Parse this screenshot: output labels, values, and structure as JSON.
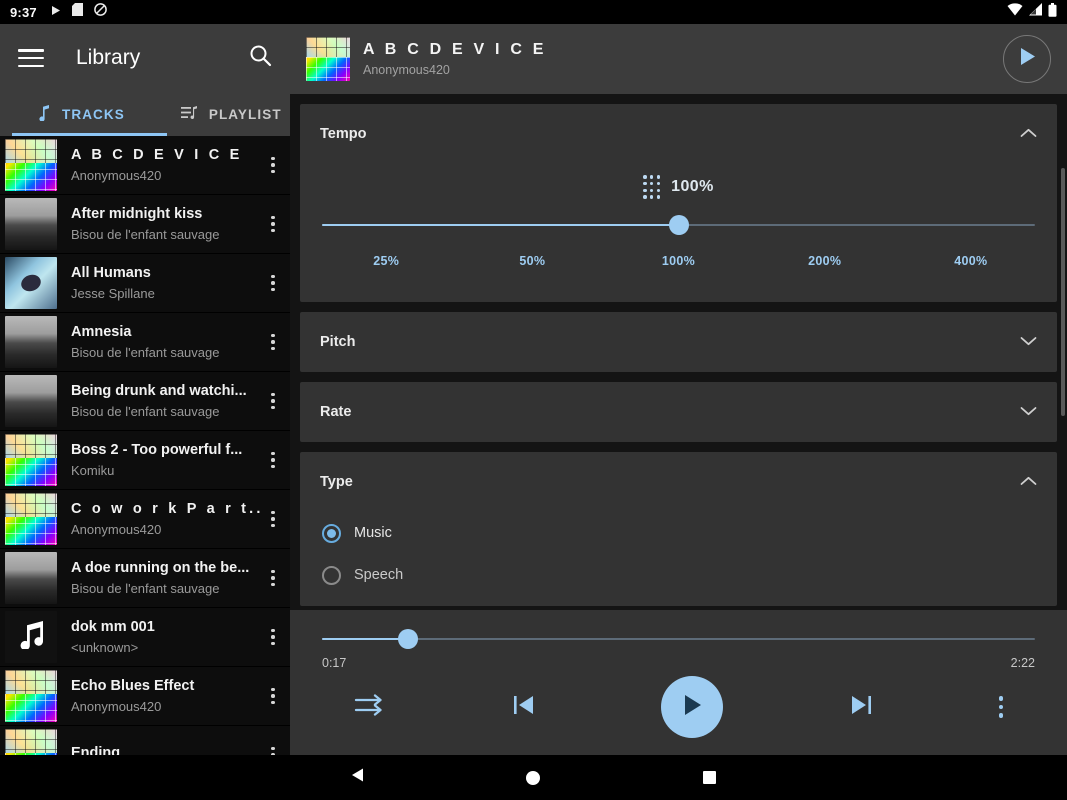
{
  "status_bar": {
    "time": "9:37",
    "icons_left": [
      "play-icon",
      "sd-card-icon",
      "mute-icon"
    ],
    "icons_right": [
      "wifi-icon",
      "signal-icon",
      "battery-icon"
    ]
  },
  "library": {
    "title": "Library",
    "menu_icon": "hamburger-menu-icon",
    "search_icon": "search-icon",
    "tabs": [
      {
        "label": "TRACKS",
        "icon": "music-note-icon",
        "active": true
      },
      {
        "label": "PLAYLIST",
        "icon": "playlist-icon",
        "active": false
      }
    ],
    "tracks": [
      {
        "title": "A B C D E V I C E",
        "artist": "Anonymous420",
        "art": "grid",
        "spaced": true
      },
      {
        "title": "After midnight kiss",
        "artist": "Bisou de l'enfant sauvage",
        "art": "gray",
        "spaced": false
      },
      {
        "title": "All Humans",
        "artist": "Jesse Spillane",
        "art": "blue",
        "spaced": false
      },
      {
        "title": "Amnesia",
        "artist": "Bisou de l'enfant sauvage",
        "art": "gray",
        "spaced": false
      },
      {
        "title": "Being drunk and watchi...",
        "artist": "Bisou de l'enfant sauvage",
        "art": "gray",
        "spaced": false
      },
      {
        "title": "Boss 2 - Too powerful f...",
        "artist": "Komiku",
        "art": "grid",
        "spaced": false
      },
      {
        "title": "C o w o r k  P a r t...",
        "artist": "Anonymous420",
        "art": "grid",
        "spaced": true
      },
      {
        "title": "A doe running on the be...",
        "artist": "Bisou de l'enfant sauvage",
        "art": "gray",
        "spaced": false
      },
      {
        "title": "dok mm 001",
        "artist": "<unknown>",
        "art": "note",
        "spaced": false
      },
      {
        "title": "Echo Blues Effect",
        "artist": "Anonymous420",
        "art": "grid",
        "spaced": false
      },
      {
        "title": "Ending",
        "artist": "",
        "art": "grid",
        "spaced": false
      }
    ]
  },
  "player": {
    "now_playing": {
      "title": "A B C D E V I C E",
      "artist": "Anonymous420",
      "art": "grid"
    },
    "header_play_icon": "play-icon",
    "effects": [
      {
        "label": "Tempo",
        "expanded": true,
        "chevron": "chevron-up-icon",
        "value_label": "100%",
        "value_icon": "dots-grid-icon",
        "slider_percent": 50,
        "ticks": [
          "25%",
          "50%",
          "100%",
          "200%",
          "400%"
        ]
      },
      {
        "label": "Pitch",
        "expanded": false,
        "chevron": "chevron-down-icon"
      },
      {
        "label": "Rate",
        "expanded": false,
        "chevron": "chevron-down-icon"
      },
      {
        "label": "Type",
        "expanded": true,
        "chevron": "chevron-up-icon",
        "options": [
          {
            "label": "Music",
            "selected": true
          },
          {
            "label": "Speech",
            "selected": false
          }
        ]
      }
    ],
    "transport": {
      "position": "0:17",
      "duration": "2:22",
      "seek_percent": 12,
      "shuffle_icon": "shuffle-icon",
      "previous_icon": "skip-previous-icon",
      "play_icon": "play-icon",
      "next_icon": "skip-next-icon",
      "more_icon": "more-vertical-icon"
    }
  },
  "nav_bar": {
    "back": "back-triangle-icon",
    "home": "home-circle-icon",
    "recents": "recents-square-icon"
  },
  "colors": {
    "accent": "#9ecdf2",
    "card": "#333333",
    "appbar": "#3c3c3c",
    "list_bg": "#0d0d0d",
    "panel_bg": "#141414"
  }
}
